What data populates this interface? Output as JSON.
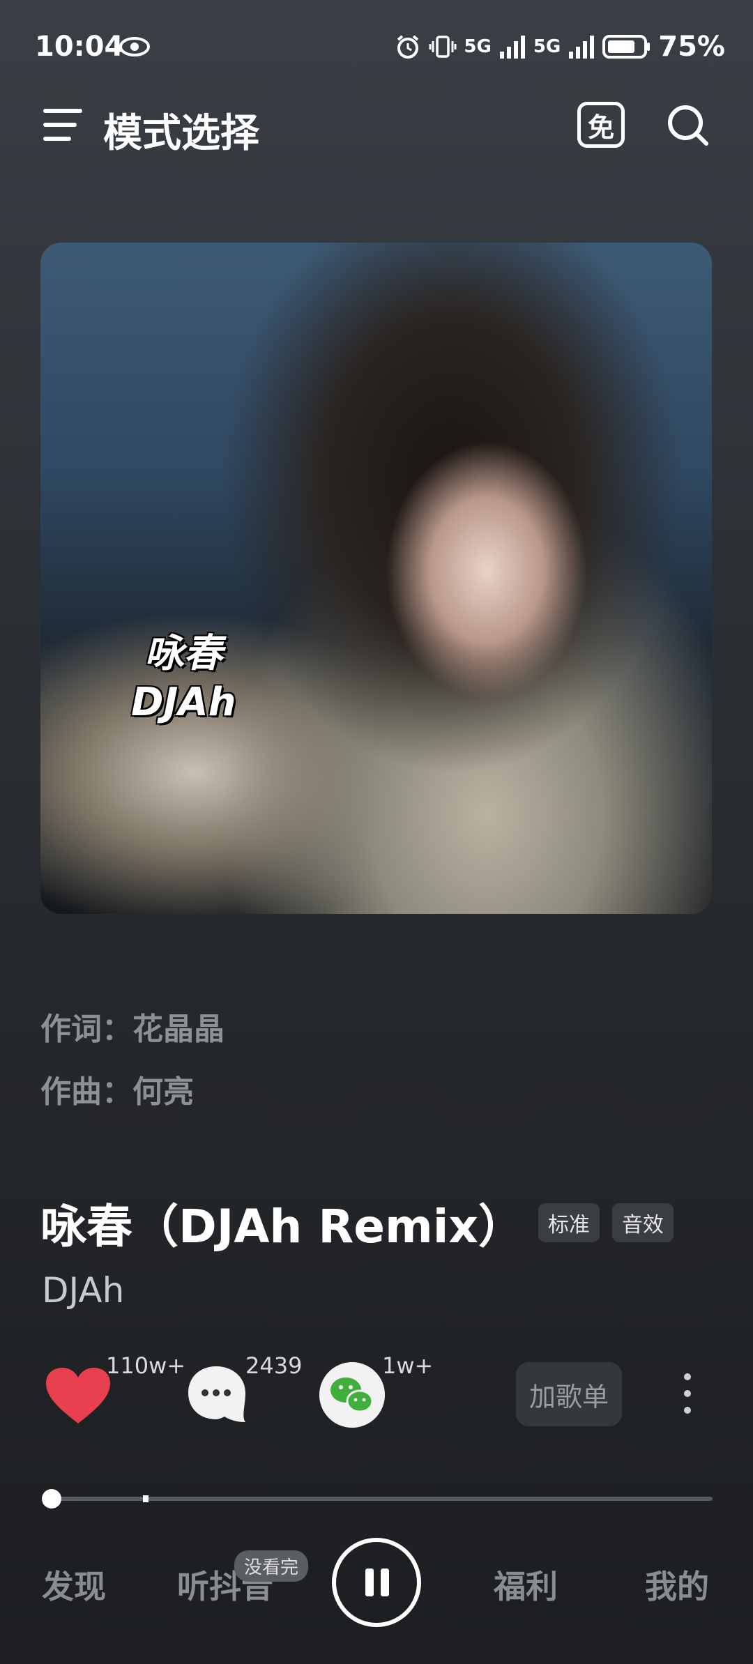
{
  "status_bar": {
    "time": "10:04",
    "net1": "5G",
    "net2": "5G",
    "battery_percent": "75%"
  },
  "header": {
    "title": "模式选择",
    "free_badge": "免"
  },
  "cover": {
    "caption_title": "咏春",
    "caption_artist": "DJAh"
  },
  "credits": {
    "lyrics": "作词：花晶晶",
    "music": "作曲：何亮"
  },
  "song": {
    "title": "咏春（DJAh Remix）",
    "tag_quality": "标准",
    "tag_effect": "音效",
    "artist": "DJAh"
  },
  "actions": {
    "like_count": "110w+",
    "comment_count": "2439",
    "share_count": "1w+",
    "add_playlist_label": "加歌单"
  },
  "player": {
    "progress_fraction": 0.0,
    "buffer_fraction": 0.14
  },
  "bottom_nav": {
    "discover": "发现",
    "douyin": "听抖音",
    "douyin_badge": "没看完",
    "welfare": "福利",
    "mine": "我的"
  },
  "colors": {
    "like_red": "#e8404f",
    "wechat_green": "#3fae3a"
  }
}
